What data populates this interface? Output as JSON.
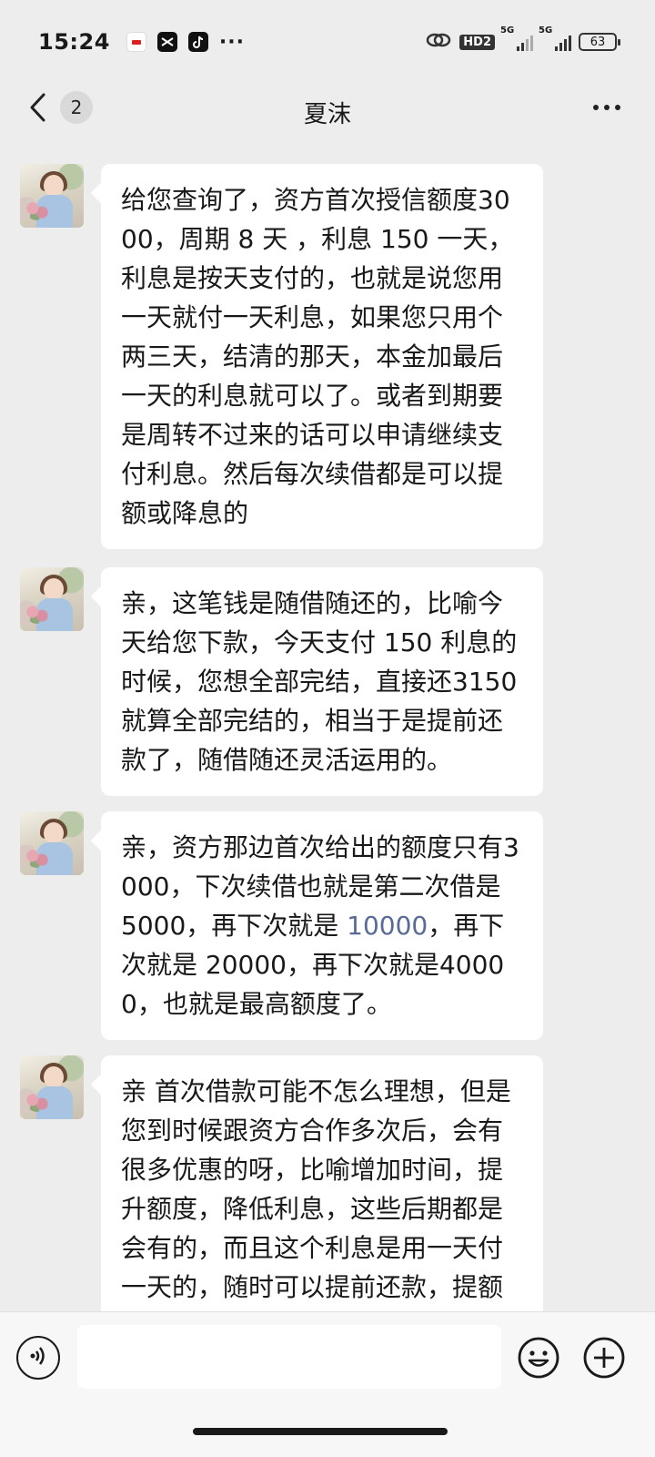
{
  "status_bar": {
    "time": "15:24",
    "app_icons": [
      "notification-app-icon",
      "capcut-icon",
      "tiktok-icon"
    ],
    "more": "···",
    "hd_label": "HD2",
    "signal_labels": [
      "5G",
      "5G"
    ],
    "battery": "63"
  },
  "nav": {
    "unread_count": "2",
    "title": "夏沫"
  },
  "messages": [
    {
      "text": "给您查询了，资方首次授信额度3000，周期 8 天 ，利息 150 一天，利息是按天支付的，也就是说您用一天就付一天利息，如果您只用个两三天，结清的那天，本金加最后一天的利息就可以了。或者到期要是周转不过来的话可以申请继续支付利息。然后每次续借都是可以提额或降息的"
    },
    {
      "text": "亲，这笔钱是随借随还的，比喻今天给您下款，今天支付 150 利息的时候，您想全部完结，直接还3150就算全部完结的，相当于是提前还款了，随借随还灵活运用的。"
    },
    {
      "text_before_link": "亲，资方那边首次给出的额度只有3000，下次续借也就是第二次借是 5000，再下次就是 ",
      "link": "10000",
      "text_after_link": "，再下次就是 20000，再下次就是40000，也就是最高额度了。"
    },
    {
      "text": "亲 首次借款可能不怎么理想，但是您到时候跟资方合作多次后，会有很多优惠的呀，比喻增加时间，提升额度，降低利息，这些后期都是会有的，而且这个利息是用一天付一天的，随时可以提前还款，提额"
    }
  ],
  "input": {
    "placeholder": "",
    "value": ""
  },
  "colors": {
    "background": "#ededed",
    "bubble": "#ffffff",
    "link": "#576b95"
  }
}
